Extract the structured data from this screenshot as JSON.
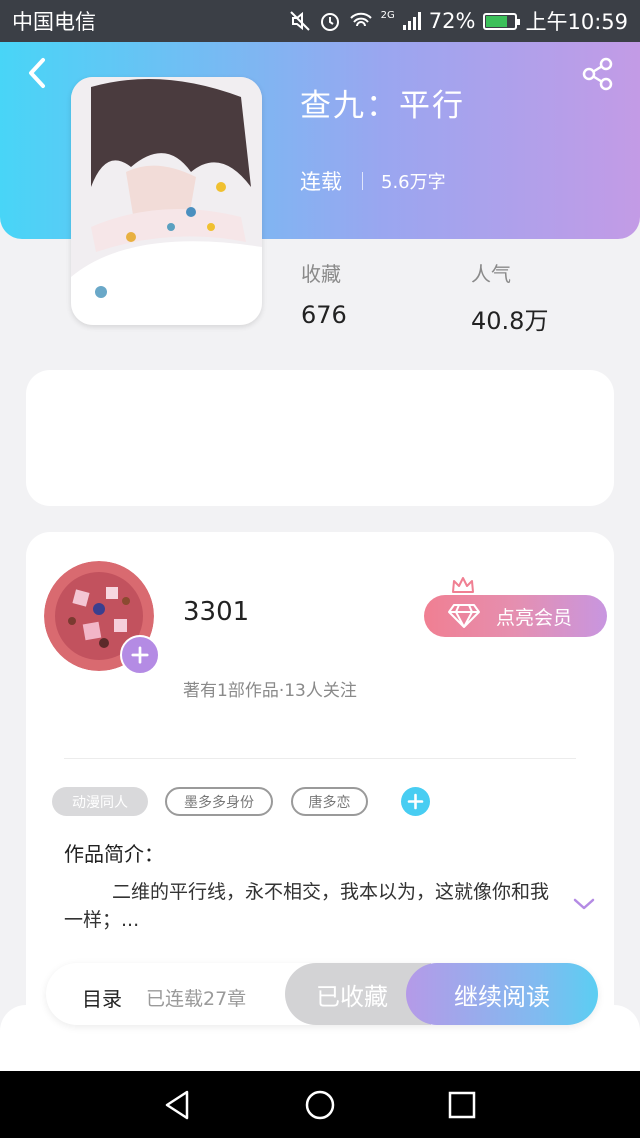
{
  "status_bar": {
    "carrier": "中国电信",
    "network": "2G",
    "battery": "72%",
    "battery_level": 0.72,
    "time": "上午10:59",
    "icons": [
      "mute-icon",
      "alarm-icon",
      "wifi-icon",
      "signal-icon",
      "battery-icon"
    ]
  },
  "book": {
    "title": "查九：平行",
    "status": "连载",
    "word_count": "5.6万字",
    "favorites_label": "收藏",
    "favorites_value": "676",
    "popularity_label": "人气",
    "popularity_value": "40.8万"
  },
  "author": {
    "name": "3301",
    "info": "著有1部作品·13人关注",
    "vip_label": "点亮会员"
  },
  "tags": [
    "动漫同人",
    "墨多多身份",
    "唐多恋"
  ],
  "intro": {
    "label": "作品简介：",
    "text": "二维的平行线，永不相交，我本以为，这就像你和我一样；..."
  },
  "action_bar": {
    "toc_label": "目录",
    "chapters": "已连载27章",
    "collected_label": "已收藏",
    "read_label": "继续阅读"
  },
  "colors": {
    "header_gradient": [
      "#48d5f7",
      "#c39be6"
    ],
    "accent_cyan": "#48cdf2",
    "accent_purple": "#b48be4",
    "vip_pink": "#f07f92"
  }
}
